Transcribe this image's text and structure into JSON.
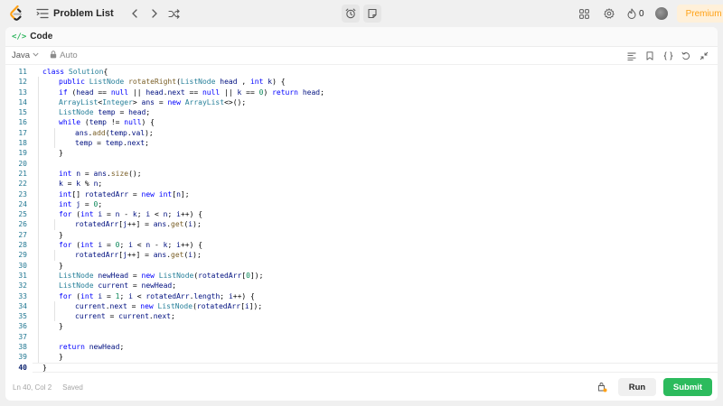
{
  "nav": {
    "title": "Problem List",
    "streak_count": "0",
    "premium_label": "Premium",
    "accent": "#ffa116"
  },
  "panel": {
    "tab_icon": "</>",
    "tab_label": "Code"
  },
  "toolbar": {
    "language": "Java",
    "mode": "Auto"
  },
  "editor": {
    "active_line": 40,
    "lines": [
      {
        "n": "11",
        "tokens": [
          [
            "kw",
            "class "
          ],
          [
            "ty",
            "Solution"
          ],
          [
            "",
            "{"
          ]
        ],
        "indent": 0
      },
      {
        "n": "12",
        "tokens": [
          [
            "kw",
            "public "
          ],
          [
            "ty",
            "ListNode "
          ],
          [
            "fn",
            "rotateRight"
          ],
          [
            "",
            "("
          ],
          [
            "ty",
            "ListNode "
          ],
          [
            "vr",
            "head"
          ],
          [
            "",
            " , "
          ],
          [
            "kw",
            "int "
          ],
          [
            "vr",
            "k"
          ],
          [
            "",
            ") {"
          ]
        ],
        "indent": 1
      },
      {
        "n": "13",
        "tokens": [
          [
            "kw",
            "if "
          ],
          [
            "",
            "("
          ],
          [
            "vr",
            "head"
          ],
          [
            "",
            " == "
          ],
          [
            "kw",
            "null "
          ],
          [
            "",
            "|| "
          ],
          [
            "vr",
            "head"
          ],
          [
            "",
            "."
          ],
          [
            "vr",
            "next"
          ],
          [
            "",
            " == "
          ],
          [
            "kw",
            "null "
          ],
          [
            "",
            "|| "
          ],
          [
            "vr",
            "k"
          ],
          [
            "",
            " == "
          ],
          [
            "nm",
            "0"
          ],
          [
            "",
            ") "
          ],
          [
            "kw",
            "return "
          ],
          [
            "vr",
            "head"
          ],
          [
            "",
            ";"
          ]
        ],
        "indent": 1
      },
      {
        "n": "14",
        "tokens": [
          [
            "ty",
            "ArrayList"
          ],
          [
            "",
            "<"
          ],
          [
            "ty",
            "Integer"
          ],
          [
            "",
            "> "
          ],
          [
            "vr",
            "ans"
          ],
          [
            "",
            " = "
          ],
          [
            "kw",
            "new "
          ],
          [
            "ty",
            "ArrayList"
          ],
          [
            "",
            "<>();"
          ]
        ],
        "indent": 1
      },
      {
        "n": "15",
        "tokens": [
          [
            "ty",
            "ListNode "
          ],
          [
            "vr",
            "temp"
          ],
          [
            "",
            " = "
          ],
          [
            "vr",
            "head"
          ],
          [
            "",
            ";"
          ]
        ],
        "indent": 1
      },
      {
        "n": "16",
        "tokens": [
          [
            "kw",
            "while "
          ],
          [
            "",
            "("
          ],
          [
            "vr",
            "temp"
          ],
          [
            "",
            " != "
          ],
          [
            "kw",
            "null"
          ],
          [
            "",
            ") {"
          ]
        ],
        "indent": 1
      },
      {
        "n": "17",
        "tokens": [
          [
            "vr",
            "ans"
          ],
          [
            "",
            "."
          ],
          [
            "fn",
            "add"
          ],
          [
            "",
            "("
          ],
          [
            "vr",
            "temp"
          ],
          [
            "",
            "."
          ],
          [
            "vr",
            "val"
          ],
          [
            "",
            ");"
          ]
        ],
        "indent": 2
      },
      {
        "n": "18",
        "tokens": [
          [
            "vr",
            "temp"
          ],
          [
            "",
            " = "
          ],
          [
            "vr",
            "temp"
          ],
          [
            "",
            "."
          ],
          [
            "vr",
            "next"
          ],
          [
            "",
            ";"
          ]
        ],
        "indent": 2
      },
      {
        "n": "19",
        "tokens": [
          [
            "",
            "}"
          ]
        ],
        "indent": 1
      },
      {
        "n": "20",
        "tokens": [],
        "indent": 1
      },
      {
        "n": "21",
        "tokens": [
          [
            "kw",
            "int "
          ],
          [
            "vr",
            "n"
          ],
          [
            "",
            " = "
          ],
          [
            "vr",
            "ans"
          ],
          [
            "",
            "."
          ],
          [
            "fn",
            "size"
          ],
          [
            "",
            "();"
          ]
        ],
        "indent": 1
      },
      {
        "n": "22",
        "tokens": [
          [
            "vr",
            "k"
          ],
          [
            "",
            " = "
          ],
          [
            "vr",
            "k"
          ],
          [
            "",
            " % "
          ],
          [
            "vr",
            "n"
          ],
          [
            "",
            ";"
          ]
        ],
        "indent": 1
      },
      {
        "n": "23",
        "tokens": [
          [
            "kw",
            "int"
          ],
          [
            "",
            "[] "
          ],
          [
            "vr",
            "rotatedArr"
          ],
          [
            "",
            " = "
          ],
          [
            "kw",
            "new "
          ],
          [
            "kw",
            "int"
          ],
          [
            "",
            "["
          ],
          [
            "vr",
            "n"
          ],
          [
            "",
            "];"
          ]
        ],
        "indent": 1
      },
      {
        "n": "24",
        "tokens": [
          [
            "kw",
            "int "
          ],
          [
            "vr",
            "j"
          ],
          [
            "",
            " = "
          ],
          [
            "nm",
            "0"
          ],
          [
            "",
            ";"
          ]
        ],
        "indent": 1
      },
      {
        "n": "25",
        "tokens": [
          [
            "kw",
            "for "
          ],
          [
            "",
            "("
          ],
          [
            "kw",
            "int "
          ],
          [
            "vr",
            "i"
          ],
          [
            "",
            " = "
          ],
          [
            "vr",
            "n"
          ],
          [
            "",
            " - "
          ],
          [
            "vr",
            "k"
          ],
          [
            "",
            "; "
          ],
          [
            "vr",
            "i"
          ],
          [
            "",
            " < "
          ],
          [
            "vr",
            "n"
          ],
          [
            "",
            "; "
          ],
          [
            "vr",
            "i"
          ],
          [
            "",
            "++) {"
          ]
        ],
        "indent": 1
      },
      {
        "n": "26",
        "tokens": [
          [
            "vr",
            "rotatedArr"
          ],
          [
            "",
            "["
          ],
          [
            "vr",
            "j"
          ],
          [
            "",
            "++] = "
          ],
          [
            "vr",
            "ans"
          ],
          [
            "",
            "."
          ],
          [
            "fn",
            "get"
          ],
          [
            "",
            "("
          ],
          [
            "vr",
            "i"
          ],
          [
            "",
            ");"
          ]
        ],
        "indent": 2
      },
      {
        "n": "27",
        "tokens": [
          [
            "",
            "}"
          ]
        ],
        "indent": 1
      },
      {
        "n": "28",
        "tokens": [
          [
            "kw",
            "for "
          ],
          [
            "",
            "("
          ],
          [
            "kw",
            "int "
          ],
          [
            "vr",
            "i"
          ],
          [
            "",
            " = "
          ],
          [
            "nm",
            "0"
          ],
          [
            "",
            "; "
          ],
          [
            "vr",
            "i"
          ],
          [
            "",
            " < "
          ],
          [
            "vr",
            "n"
          ],
          [
            "",
            " - "
          ],
          [
            "vr",
            "k"
          ],
          [
            "",
            "; "
          ],
          [
            "vr",
            "i"
          ],
          [
            "",
            "++) {"
          ]
        ],
        "indent": 1
      },
      {
        "n": "29",
        "tokens": [
          [
            "vr",
            "rotatedArr"
          ],
          [
            "",
            "["
          ],
          [
            "vr",
            "j"
          ],
          [
            "",
            "++] = "
          ],
          [
            "vr",
            "ans"
          ],
          [
            "",
            "."
          ],
          [
            "fn",
            "get"
          ],
          [
            "",
            "("
          ],
          [
            "vr",
            "i"
          ],
          [
            "",
            ");"
          ]
        ],
        "indent": 2
      },
      {
        "n": "30",
        "tokens": [
          [
            "",
            "}"
          ]
        ],
        "indent": 1
      },
      {
        "n": "31",
        "tokens": [
          [
            "ty",
            "ListNode "
          ],
          [
            "vr",
            "newHead"
          ],
          [
            "",
            " = "
          ],
          [
            "kw",
            "new "
          ],
          [
            "ty",
            "ListNode"
          ],
          [
            "",
            "("
          ],
          [
            "vr",
            "rotatedArr"
          ],
          [
            "",
            "["
          ],
          [
            "nm",
            "0"
          ],
          [
            "",
            "]);"
          ]
        ],
        "indent": 1
      },
      {
        "n": "32",
        "tokens": [
          [
            "ty",
            "ListNode "
          ],
          [
            "vr",
            "current"
          ],
          [
            "",
            " = "
          ],
          [
            "vr",
            "newHead"
          ],
          [
            "",
            ";"
          ]
        ],
        "indent": 1
      },
      {
        "n": "33",
        "tokens": [
          [
            "kw",
            "for "
          ],
          [
            "",
            "("
          ],
          [
            "kw",
            "int "
          ],
          [
            "vr",
            "i"
          ],
          [
            "",
            " = "
          ],
          [
            "nm",
            "1"
          ],
          [
            "",
            "; "
          ],
          [
            "vr",
            "i"
          ],
          [
            "",
            " < "
          ],
          [
            "vr",
            "rotatedArr"
          ],
          [
            "",
            "."
          ],
          [
            "vr",
            "length"
          ],
          [
            "",
            "; "
          ],
          [
            "vr",
            "i"
          ],
          [
            "",
            "++) {"
          ]
        ],
        "indent": 1
      },
      {
        "n": "34",
        "tokens": [
          [
            "vr",
            "current"
          ],
          [
            "",
            "."
          ],
          [
            "vr",
            "next"
          ],
          [
            "",
            " = "
          ],
          [
            "kw",
            "new "
          ],
          [
            "ty",
            "ListNode"
          ],
          [
            "",
            "("
          ],
          [
            "vr",
            "rotatedArr"
          ],
          [
            "",
            "["
          ],
          [
            "vr",
            "i"
          ],
          [
            "",
            "]);"
          ]
        ],
        "indent": 2
      },
      {
        "n": "35",
        "tokens": [
          [
            "vr",
            "current"
          ],
          [
            "",
            " = "
          ],
          [
            "vr",
            "current"
          ],
          [
            "",
            "."
          ],
          [
            "vr",
            "next"
          ],
          [
            "",
            ";"
          ]
        ],
        "indent": 2
      },
      {
        "n": "36",
        "tokens": [
          [
            "",
            "}"
          ]
        ],
        "indent": 1
      },
      {
        "n": "37",
        "tokens": [],
        "indent": 1
      },
      {
        "n": "38",
        "tokens": [
          [
            "kw",
            "return "
          ],
          [
            "vr",
            "newHead"
          ],
          [
            "",
            ";"
          ]
        ],
        "indent": 1
      },
      {
        "n": "39",
        "tokens": [
          [
            "",
            "}"
          ]
        ],
        "indent": 1
      },
      {
        "n": "40",
        "tokens": [
          [
            "",
            "}"
          ]
        ],
        "indent": 0
      }
    ]
  },
  "footer": {
    "cursor_position": "Ln 40, Col 2",
    "save_status": "Saved",
    "run_label": "Run",
    "submit_label": "Submit",
    "submit_color": "#2cbb5d"
  }
}
